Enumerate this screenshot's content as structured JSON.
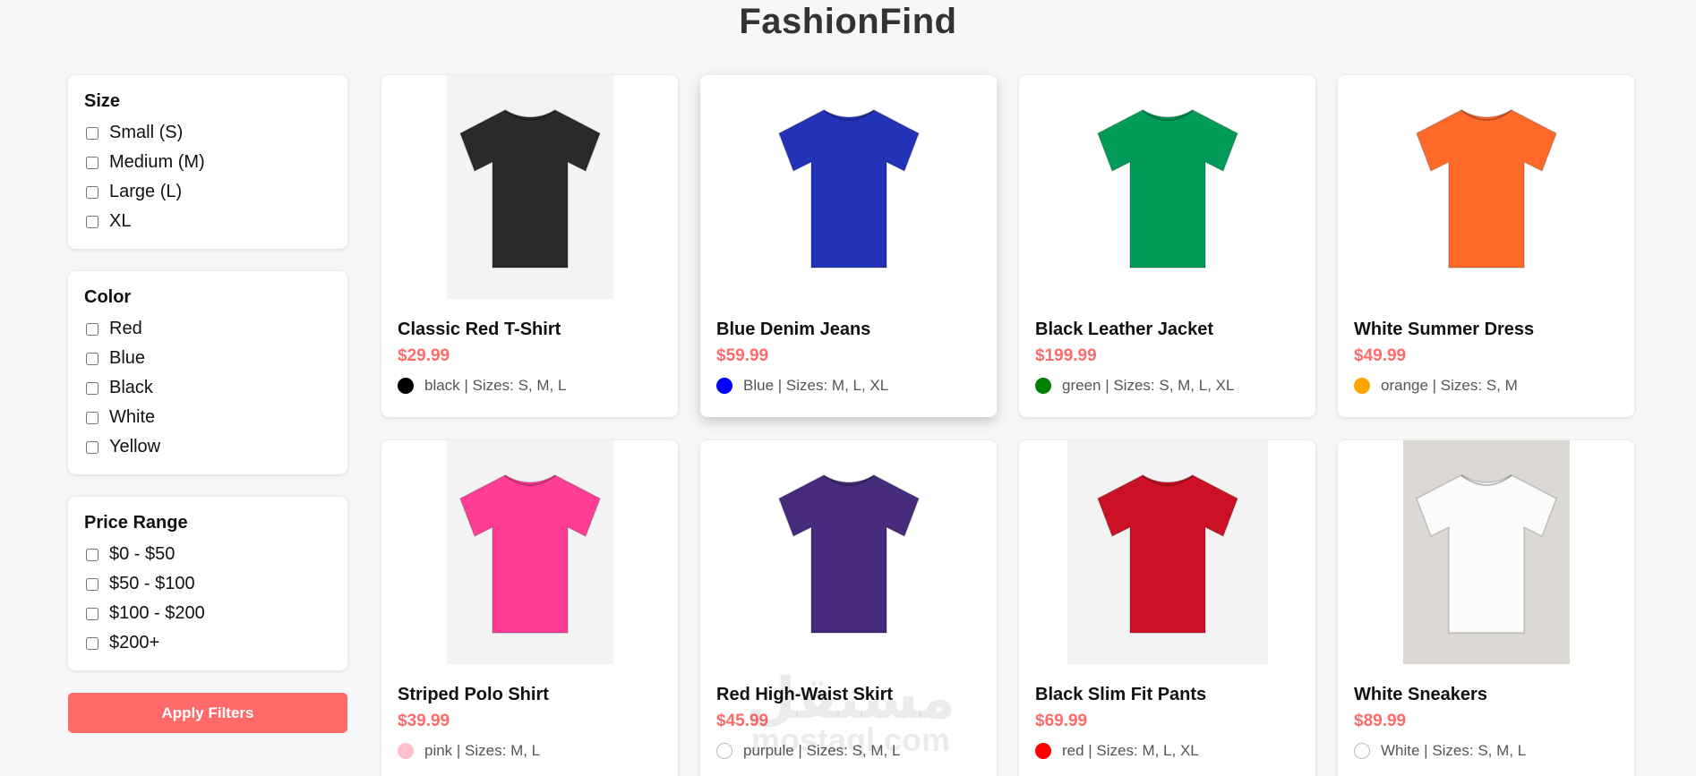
{
  "header": {
    "title": "FashionFind"
  },
  "filters": {
    "size": {
      "title": "Size",
      "options": [
        "Small (S)",
        "Medium (M)",
        "Large (L)",
        "XL"
      ]
    },
    "color": {
      "title": "Color",
      "options": [
        "Red",
        "Blue",
        "Black",
        "White",
        "Yellow"
      ]
    },
    "price": {
      "title": "Price Range",
      "options": [
        "$0 - $50",
        "$50 - $100",
        "$100 - $200",
        "$200+"
      ]
    },
    "apply_label": "Apply Filters"
  },
  "products": [
    {
      "name": "Classic Red T-Shirt",
      "price": "$29.99",
      "meta": "black | Sizes: S, M, L",
      "swatch": "#000000",
      "shirt": "#2a2a2a",
      "img_bg": "#f3f3f3"
    },
    {
      "name": "Blue Denim Jeans",
      "price": "$59.99",
      "meta": "Blue | Sizes: M, L, XL",
      "swatch": "#0000ff",
      "shirt": "#2233b8",
      "img_bg": "#ffffff"
    },
    {
      "name": "Black Leather Jacket",
      "price": "$199.99",
      "meta": "green | Sizes: S, M, L, XL",
      "swatch": "#008000",
      "shirt": "#009b58",
      "img_bg": "#ffffff"
    },
    {
      "name": "White Summer Dress",
      "price": "$49.99",
      "meta": "orange | Sizes: S, M",
      "swatch": "#ffa500",
      "shirt": "#ff6a2a",
      "img_bg": "#ffffff"
    },
    {
      "name": "Striped Polo Shirt",
      "price": "$39.99",
      "meta": "pink | Sizes: M, L",
      "swatch": "#ffc0cb",
      "shirt": "#ff3d95",
      "img_bg": "#f3f3f3"
    },
    {
      "name": "Red High-Waist Skirt",
      "price": "$45.99",
      "meta": "purpule | Sizes: S, M, L",
      "swatch": "#ffffff",
      "shirt": "#462b7d",
      "img_bg": "#ffffff"
    },
    {
      "name": "Black Slim Fit Pants",
      "price": "$69.99",
      "meta": "red | Sizes: M, L, XL",
      "swatch": "#ff0000",
      "shirt": "#cc1124",
      "img_bg": "#f3f3f3"
    },
    {
      "name": "White Sneakers",
      "price": "$89.99",
      "meta": "White | Sizes: S, M, L",
      "swatch": "#ffffff",
      "shirt": "#fbfbfb",
      "img_bg": "#dcd8d4"
    }
  ],
  "watermark": {
    "arabic": "مستقل",
    "latin": "mostaql.com"
  }
}
